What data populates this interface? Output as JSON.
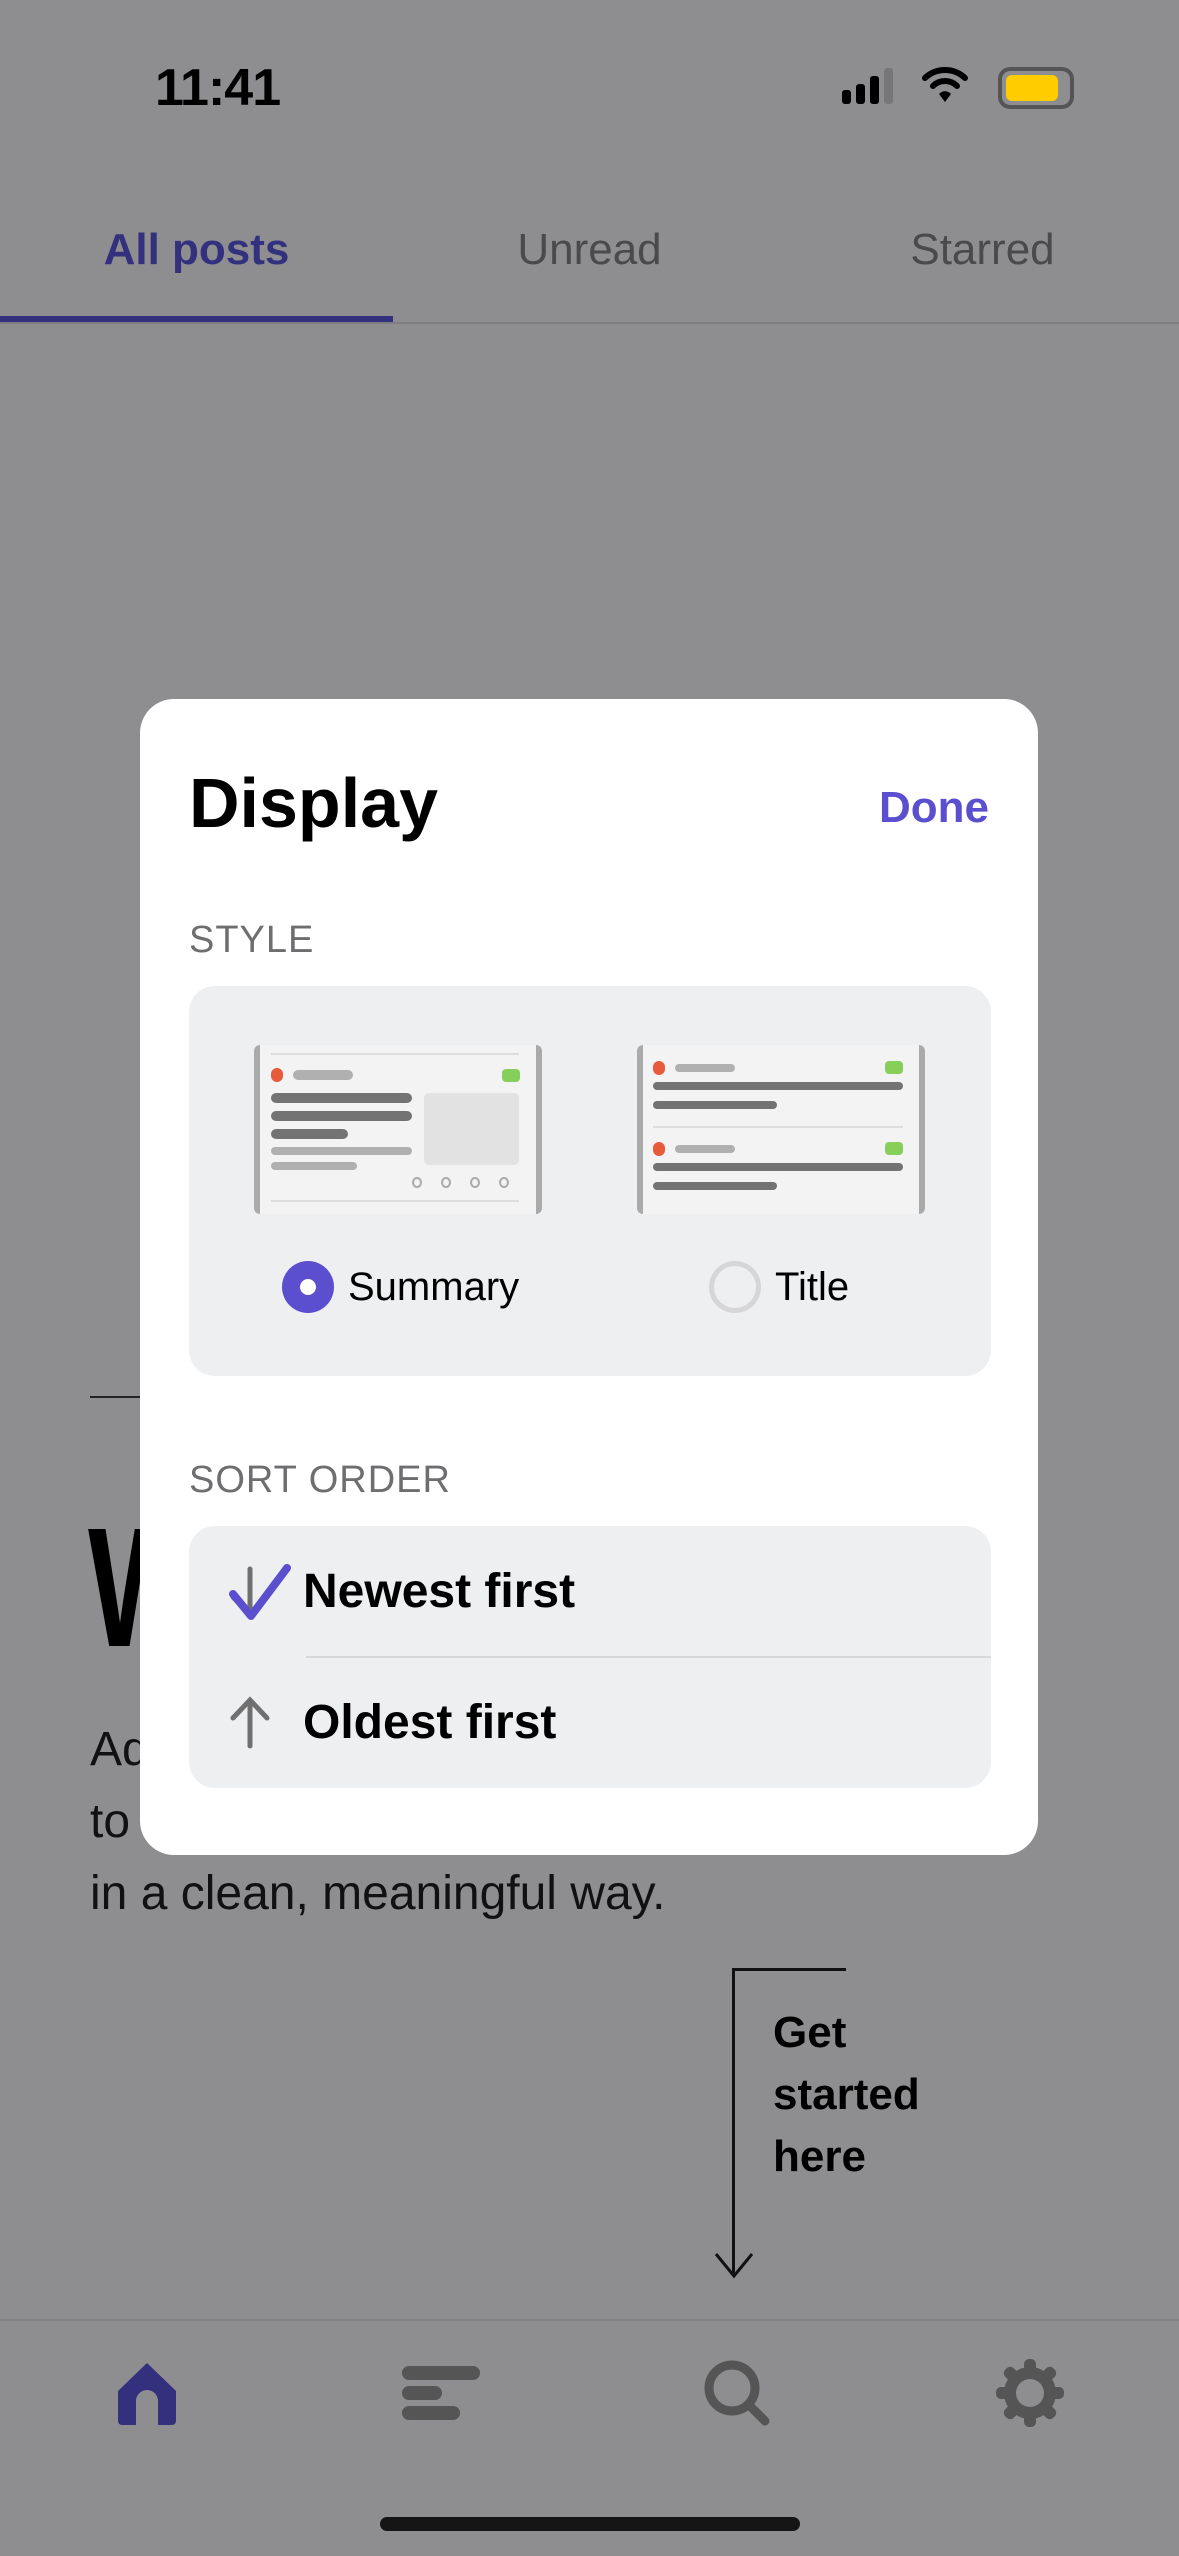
{
  "status_bar": {
    "time": "11:41",
    "battery_color": "#ffcc00"
  },
  "tabs": [
    {
      "label": "All posts",
      "active": true
    },
    {
      "label": "Unread",
      "active": false
    },
    {
      "label": "Starred",
      "active": false
    }
  ],
  "background": {
    "heading_fragment": "W",
    "text_lines": [
      "Ad",
      "to",
      "in a clean, meaningful way."
    ],
    "guide_text": "Get started here"
  },
  "modal": {
    "title": "Display",
    "done_label": "Done",
    "style_label": "STYLE",
    "style_options": [
      {
        "label": "Summary",
        "selected": true
      },
      {
        "label": "Title",
        "selected": false
      }
    ],
    "sort_label": "SORT ORDER",
    "sort_options": [
      {
        "label": "Newest first",
        "icon": "arrow-down-icon",
        "selected": true
      },
      {
        "label": "Oldest first",
        "icon": "arrow-up-icon",
        "selected": false
      }
    ]
  },
  "bottom_nav": [
    {
      "icon": "home-icon",
      "active": true
    },
    {
      "icon": "list-icon"
    },
    {
      "icon": "search-icon"
    },
    {
      "icon": "gear-icon"
    }
  ],
  "colors": {
    "accent": "#5b4fcf",
    "tab_active": "#33307d",
    "overlay": "#8e8e90"
  }
}
